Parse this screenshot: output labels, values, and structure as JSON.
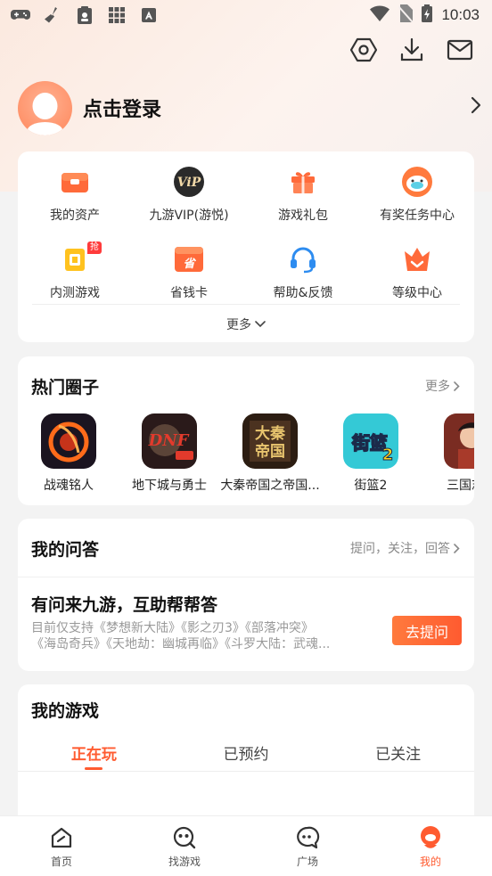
{
  "status_bar": {
    "time": "10:03",
    "left_icons": [
      "gamepad-icon",
      "broom-icon",
      "clipboard-icon",
      "grid-icon",
      "font-a-icon"
    ],
    "right_icons": [
      "wifi-icon",
      "no-sim-icon",
      "battery-charging-icon"
    ]
  },
  "toolbar": {
    "icons": [
      "settings-hex-icon",
      "download-icon",
      "mail-icon"
    ]
  },
  "profile": {
    "login_label": "点击登录"
  },
  "menu": {
    "items": [
      {
        "label": "我的资产",
        "icon": "wallet-icon"
      },
      {
        "label": "九游VIP(游悦)",
        "icon": "vip-icon"
      },
      {
        "label": "游戏礼包",
        "icon": "gift-icon"
      },
      {
        "label": "有奖任务中心",
        "icon": "task-mascot-icon"
      },
      {
        "label": "内测游戏",
        "icon": "beta-game-icon",
        "badge": "抢"
      },
      {
        "label": "省钱卡",
        "icon": "saving-card-icon"
      },
      {
        "label": "帮助&反馈",
        "icon": "headset-icon"
      },
      {
        "label": "等级中心",
        "icon": "level-crown-icon"
      }
    ],
    "more_label": "更多"
  },
  "circles": {
    "title": "热门圈子",
    "more_label": "更多",
    "items": [
      {
        "label": "战魂铭人"
      },
      {
        "label": "地下城与勇士"
      },
      {
        "label": "大秦帝国之帝国..."
      },
      {
        "label": "街篮2"
      },
      {
        "label": "三国志幻"
      }
    ]
  },
  "qa": {
    "title": "我的问答",
    "more_label": "提问，关注，回答",
    "heading": "有问来九游，互助帮帮答",
    "desc_line1": "目前仅支持《梦想新大陆》《影之刃3》《部落冲突》",
    "desc_line2": "《海岛奇兵》《天地劫：幽城再临》《斗罗大陆：武魂...",
    "ask_button": "去提问"
  },
  "games": {
    "title": "我的游戏",
    "tabs": [
      "正在玩",
      "已预约",
      "已关注"
    ],
    "active_tab": 0
  },
  "bottom_nav": {
    "items": [
      {
        "label": "首页",
        "icon": "home-icon"
      },
      {
        "label": "找游戏",
        "icon": "find-game-icon"
      },
      {
        "label": "广场",
        "icon": "square-chat-icon"
      },
      {
        "label": "我的",
        "icon": "profile-mascot-icon"
      }
    ],
    "active": 3
  },
  "colors": {
    "accent": "#ff5b30",
    "accent_light": "#ff7a3d"
  }
}
